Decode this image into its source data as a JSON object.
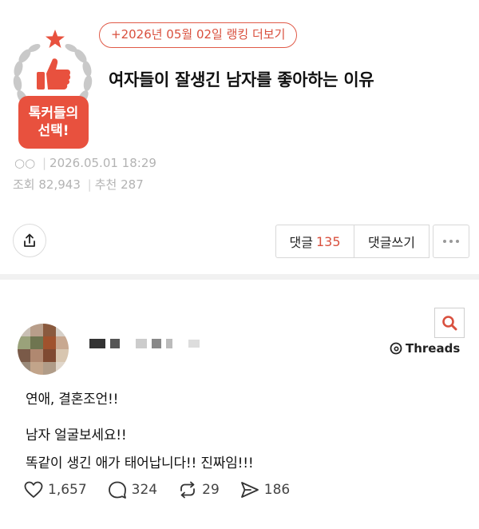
{
  "badge": {
    "line1": "톡커들의",
    "line2": "선택!",
    "icons": [
      "star-icon",
      "laurel-wreath-icon",
      "thumbs-up-icon"
    ],
    "color": "#e8513e"
  },
  "ranking_link": "+2026년 05월 02일 랭킹 더보기",
  "post": {
    "title": "여자들이 잘생긴 남자를 좋아하는 이유",
    "date": "2026.05.01 18:29",
    "views_label": "조회",
    "views": "82,943",
    "likes_label": "추천",
    "likes": "287"
  },
  "actions": {
    "comments_label": "댓글",
    "comments_count": "135",
    "write_label": "댓글쓰기",
    "share_icon": "share-icon",
    "more_icon": "more-dots-icon"
  },
  "embed": {
    "brand": "Threads",
    "lines": [
      "연애, 결혼조언!!",
      "남자 얼굴보세요!!",
      "똑같이 생긴 애가 태어납니다!! 진짜임!!!"
    ],
    "stats": {
      "likes": "1,657",
      "comments": "324",
      "reposts": "29",
      "shares": "186"
    }
  },
  "colors": {
    "accent": "#d9503e",
    "meta_text": "#b3b3b3"
  }
}
